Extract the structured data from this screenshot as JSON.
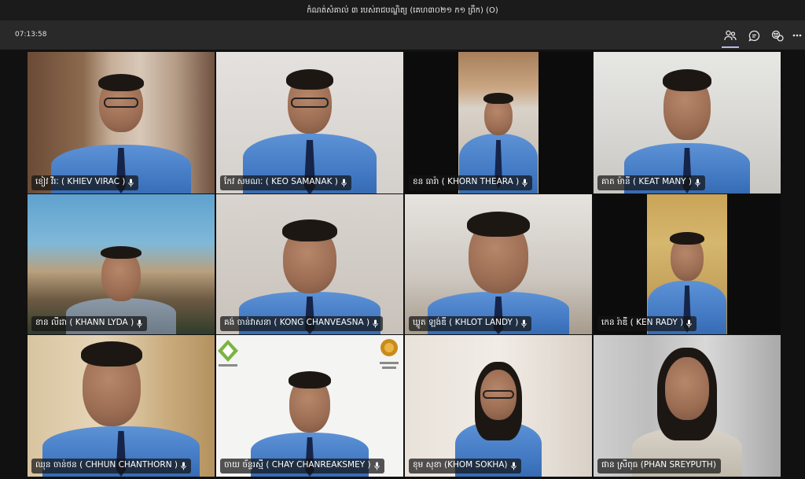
{
  "window": {
    "title": "កំណត់សំគាល់ ៣ របស់រាជបណ្ឌិត្យ (គេហ៣០២១ ក១ ព្រឹក) (O)"
  },
  "toolbar": {
    "timer": "07:13:58",
    "icons": [
      "participants-icon",
      "chat-icon",
      "reactions-icon",
      "more-icon"
    ]
  },
  "participants": [
    {
      "label": "ខៀវ វីរៈ ( KHIEV VIRAC )"
    },
    {
      "label": "កែវ សមណៈ ( KEO SAMANAK )"
    },
    {
      "label": "ខន ធារ៉ា ( KHORN THEARA )"
    },
    {
      "label": "គាត ម៉ានី ( KEAT MANY )"
    },
    {
      "label": "ខាន លីដា ( KHANN LYDA )"
    },
    {
      "label": "គង់ ចាន់វាសនា ( KONG CHANVEASNA )"
    },
    {
      "label": "ឃ្លូត ឡង់ឌី ( KHLOT LANDY )"
    },
    {
      "label": "កេន រ៉ាឌី ( KEN RADY )"
    },
    {
      "label": "ឈុន ចាន់ថន ( CHHUN CHANTHORN )"
    },
    {
      "label": "ចាយ ច័ន្ទរស្មី ( CHAY CHANREAKSMEY )"
    },
    {
      "label": "ខុម សុខា (KHOM SOKHA)"
    },
    {
      "label": "ផាន ស្រីពុធ (PHAN SREYPUTH)"
    }
  ],
  "colors": {
    "accent": "#b6b8f0",
    "shirt": "#4a82cc",
    "label_bg": "#141414"
  }
}
